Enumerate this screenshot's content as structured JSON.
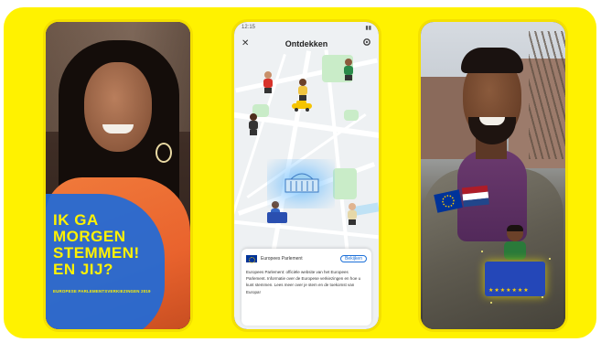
{
  "colors": {
    "brand_yellow": "#fff200",
    "overlay_blue": "#1f6ad8",
    "eu_blue": "#003399",
    "eu_star": "#ffcc00"
  },
  "phone1": {
    "headline_lines": [
      "IK GA",
      "MORGEN",
      "STEMMEN!",
      "EN JIJ?"
    ],
    "subline": "EUROPESE PARLEMENTSVERKIEZINGEN 2019"
  },
  "phone2": {
    "status_time": "12:15",
    "header_title": "Ontdekken",
    "close_icon": "close-icon",
    "settings_icon": "gear-icon",
    "card": {
      "title": "Europees Parlement",
      "action_label": "Bekijken",
      "body": "Europees Parlement: officiële website van het Europees Parlement. Informatie over de Europese verkiezingen en hoe u kunt stemmen. Lees meer over je stem en de toekomst van Europa!"
    }
  },
  "phone3": {
    "flags": [
      "eu-flag",
      "netherlands-flag"
    ],
    "ballot_box_stars": "★★★★★★★"
  }
}
